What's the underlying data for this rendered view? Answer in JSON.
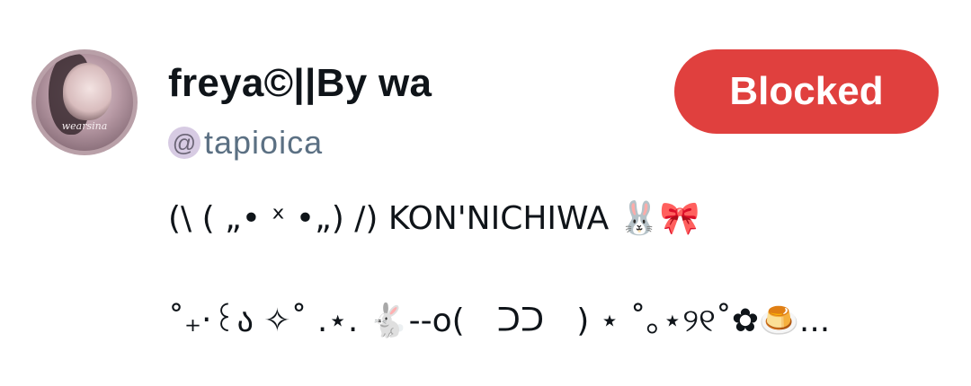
{
  "profile": {
    "display_name": "freya©||By wa",
    "handle_prefix": "@",
    "handle": "tapioica",
    "avatar_caption": "wearsina",
    "accent_color": "#e0403e"
  },
  "actions": {
    "blocked_label": "Blocked"
  },
  "bio": {
    "line1": "(\\ ( „• ˣ •„) /) KON'NICHIWA 🐰🎀",
    "line2": "˚₊‧꒰ა ✧˚ .⋆. 🐇--o(　ᑐᑐ　) ⋆ ˚｡⋆୨୧˚✿🍮..."
  }
}
